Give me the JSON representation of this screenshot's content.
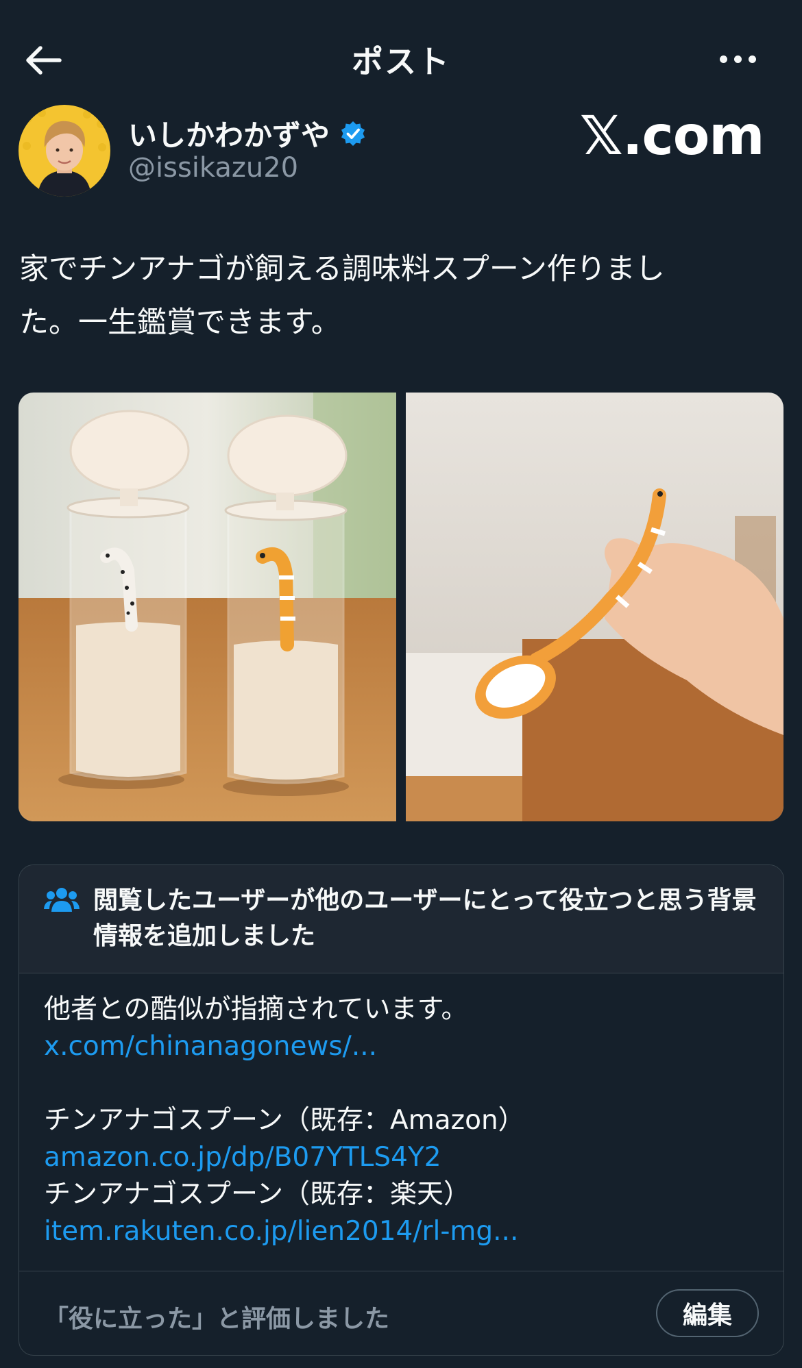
{
  "header": {
    "title": "ポスト"
  },
  "author": {
    "name": "いしかわかずや",
    "handle": "@issikazu20",
    "verified": true
  },
  "watermark": "𝕏.com",
  "tweet": {
    "line1": "家でチンアナゴが飼える調味料スプーン作りまし",
    "line2": "た。一生鑑賞できます。"
  },
  "community_note": {
    "title": "閲覧したユーザーが他のユーザーにとって役立つと思う背景情報を追加しました",
    "body_intro": "他者との酷似が指摘されています。",
    "link1": "x.com/chinanagonews/...",
    "item2_label": "チンアナゴスプーン（既存：Amazon）",
    "link2": "amazon.co.jp/dp/B07YTLS4Y2",
    "item3_label": "チンアナゴスプーン（既存：楽天）",
    "link3": "item.rakuten.co.jp/lien2014/rl-mg...",
    "rated_text": "「役に立った」と評価しました",
    "edit_label": "編集"
  },
  "colors": {
    "background": "#15202b",
    "link": "#1d9bf0",
    "verified": "#1d9bf0",
    "secondary_text": "#8b98a5"
  }
}
